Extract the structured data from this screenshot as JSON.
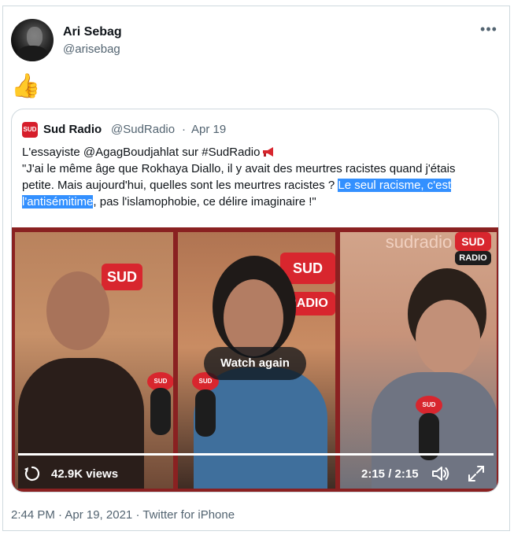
{
  "tweet": {
    "author": {
      "name": "Ari Sebag",
      "handle": "@arisebag"
    },
    "more_icon_text": "•••",
    "body_emoji": "👍"
  },
  "quoted": {
    "logo_text": "SUD",
    "author_name": "Sud Radio",
    "author_handle": "@SudRadio",
    "separator": "·",
    "date": "Apr 19",
    "text_line1": "L'essayiste @AgagBoudjahlat sur #SudRadio",
    "text_line2": "\"J'ai le même âge que Rokhaya Diallo, il y avait des meurtres racistes quand j'étais",
    "text_line3_pre": "petite. Mais aujourd'hui, quelles sont les meurtres racistes ? ",
    "text_line3_hl": "Le seul racisme, c'est",
    "text_line4_hl": "l'antisémitime",
    "text_line4_post": ", pas l'islamophobie, ce délire imaginaire !\"",
    "megaphone_icon": "megaphone-icon"
  },
  "video": {
    "overlay_button": "Watch again",
    "views": "42.9K views",
    "time": "2:15 / 2:15",
    "progress": 1.0,
    "sign_text_sud": "SUD",
    "sign_text_radio": "RADIO",
    "sign_text_sudradio": "sudradio",
    "mic_flag_text": "SUD"
  },
  "footer": {
    "timestamp": "2:44 PM · Apr 19, 2021",
    "separator": "·",
    "source": "Twitter for iPhone"
  },
  "colors": {
    "accent_highlight": "#3390ff",
    "secondary_text": "#536471",
    "border": "#cfd9de",
    "brand_red": "#d8262e"
  }
}
